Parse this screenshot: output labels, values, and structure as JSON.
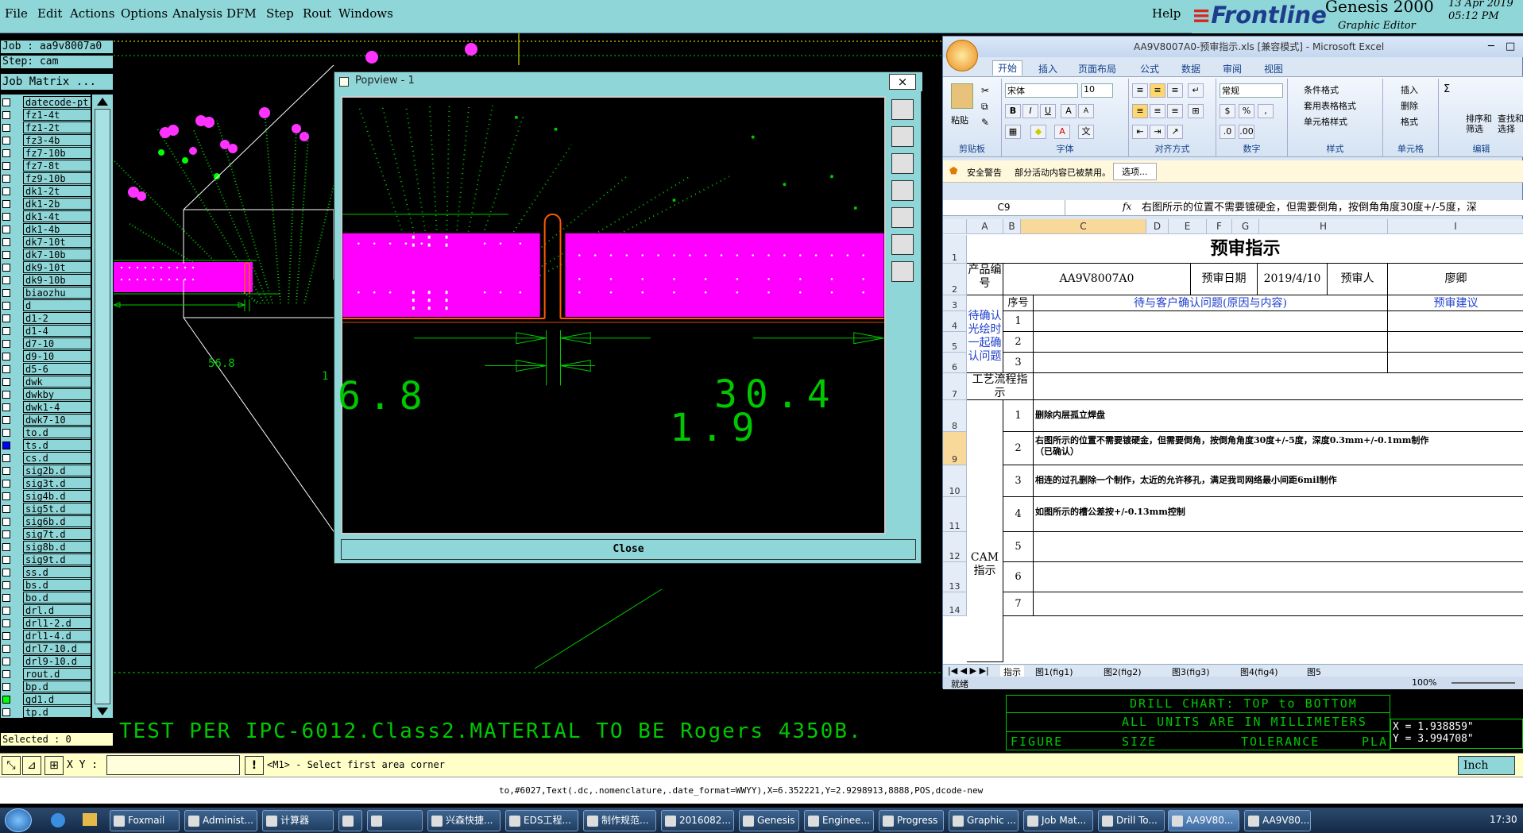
{
  "menubar": {
    "items": [
      "File",
      "Edit",
      "Actions",
      "Options",
      "Analysis",
      "DFM",
      "Step",
      "Rout",
      "Windows"
    ],
    "help": "Help",
    "brand": {
      "name": "Frontline",
      "product": "Genesis 2000",
      "subtitle": "Graphic Editor",
      "date": "13 Apr 2019",
      "time": "05:12 PM"
    }
  },
  "leftpanel": {
    "job": "Job : aa9v8007a0",
    "step": "Step: cam",
    "matrix_button": "Job Matrix ...",
    "layers": [
      "datecode-pt",
      "fz1-4t",
      "fz1-2t",
      "fz3-4b",
      "fz7-10b",
      "fz7-8t",
      "fz9-10b",
      "dk1-2t",
      "dk1-2b",
      "dk1-4t",
      "dk1-4b",
      "dk7-10t",
      "dk7-10b",
      "dk9-10t",
      "dk9-10b",
      "biaozhu",
      "d",
      "d1-2",
      "d1-4",
      "d7-10",
      "d9-10",
      "d5-6",
      "dwk",
      "dwkby",
      "dwk1-4",
      "dwk7-10",
      "to.d",
      "ts.d",
      "cs.d",
      "sig2b.d",
      "sig3t.d",
      "sig4b.d",
      "sig5t.d",
      "sig6b.d",
      "sig7t.d",
      "sig8b.d",
      "sig9t.d",
      "ss.d",
      "bs.d",
      "bo.d",
      "drl.d",
      "drl1-2.d",
      "drl1-4.d",
      "drl7-10.d",
      "drl9-10.d",
      "rout.d",
      "bp.d",
      "gd1.d",
      "tp.d"
    ],
    "selected": "Selected : 0"
  },
  "canvas": {
    "dim_main": "56.8",
    "dim_small": "1",
    "bottom_text": "TEST PER IPC-6012.Class2.MATERIAL TO BE Rogers 4350B.",
    "drill_chart": {
      "title": "DRILL CHART: TOP to BOTTOM",
      "units": "ALL UNITS ARE IN MILLIMETERS",
      "headers": [
        "FIGURE",
        "SIZE",
        "TOLERANCE",
        "PLA"
      ]
    },
    "coord_x": "X = 1.938859\"",
    "coord_y": "Y = 3.994708\""
  },
  "popview": {
    "title": "Popview - 1",
    "close_x": "×",
    "dim_left": "6.8",
    "dim_right": "30.4",
    "dim_center": "1.9",
    "close_label": "Close"
  },
  "cmdbar": {
    "xy_label": "X Y :",
    "xy_value": "",
    "prompt": "<M1> - Select first area corner",
    "unit": "Inch"
  },
  "statusline": "to,#6027,Text(.dc,.nomenclature,.date_format=WWYY),X=6.352221,Y=2.9298913,8888,POS,dcode-new",
  "excel": {
    "title": "AA9V8007A0-预审指示.xls [兼容模式] - Microsoft Excel",
    "tabs": [
      "开始",
      "插入",
      "页面布局",
      "公式",
      "数据",
      "审阅",
      "视图"
    ],
    "font_name": "宋体",
    "font_size": "10",
    "number_format": "常规",
    "groups": [
      "剪贴板",
      "字体",
      "对齐方式",
      "数字",
      "样式",
      "单元格",
      "编辑"
    ],
    "style_items": [
      "条件格式",
      "套用表格格式",
      "单元格样式"
    ],
    "cell_items": [
      "插入",
      "删除",
      "格式"
    ],
    "edit_items": [
      "排序和筛选",
      "查找和选择"
    ],
    "paste": "粘贴",
    "security_label": "安全警告",
    "security_msg": "部分活动内容已被禁用。",
    "security_btn": "选项...",
    "namebox": "C9",
    "fx": "fx",
    "formula": "右图所示的位置不需要镀硬金，但需要倒角，按倒角角度30度+/-5度，深",
    "columns": [
      "A",
      "B",
      "C",
      "D",
      "E",
      "F",
      "G",
      "H",
      "I"
    ],
    "rows": [
      "1",
      "2",
      "3",
      "4",
      "5",
      "6",
      "7",
      "8",
      "9",
      "10",
      "11",
      "12",
      "13",
      "14"
    ],
    "sheet_title": "预审指示",
    "product_no_label": "产品编号",
    "product_no": "AA9V8007A0",
    "review_date_label": "预审日期",
    "review_date": "2019/4/10",
    "reviewer_label": "预审人",
    "reviewer": "廖卿",
    "seq_label": "序号",
    "confirm_header": "待与客户确认问题(原因与内容)",
    "suggest_header": "预审建议",
    "confirm_block": "待确认光绘时一起确认问题",
    "process_label": "工艺流程指示",
    "cam_label": "CAM指示",
    "cam_items": [
      {
        "n": "1",
        "text": "删除内层孤立焊盘"
      },
      {
        "n": "2",
        "text": "右图所示的位置不需要镀硬金，但需要倒角，按倒角角度30度+/-5度，深度0.3mm+/-0.1mm制作",
        "text2": "（已确认）"
      },
      {
        "n": "3",
        "text": "相连的过孔删除一个制作，太近的允许移孔，满足我司网络最小间距6mil制作"
      },
      {
        "n": "4",
        "text": "如图所示的槽公差按+/-0.13mm控制"
      },
      {
        "n": "5",
        "text": ""
      },
      {
        "n": "6",
        "text": ""
      },
      {
        "n": "7",
        "text": ""
      }
    ],
    "confirm_nums": [
      "1",
      "2",
      "3"
    ],
    "sheets": [
      "指示",
      "图1(fig1)",
      "图2(fig2)",
      "图3(fig3)",
      "图4(fig4)",
      "图5"
    ],
    "status": "就绪",
    "zoom": "100%"
  },
  "taskbar": {
    "items": [
      "Foxmail",
      "Administ...",
      "计算器",
      "",
      "",
      "兴森快捷...",
      "EDS工程...",
      "制作规范...",
      "2016082...",
      "Genesis",
      "Enginee...",
      "Progress",
      "Graphic ...",
      "Job Mat...",
      "Drill To...",
      "AA9V80...",
      "AA9V80..."
    ],
    "clock": "17:30"
  },
  "colors": {
    "teal": "#8ed6d8",
    "magenta": "#ff00ff",
    "green": "#00c800",
    "cream": "#ffffc8"
  }
}
